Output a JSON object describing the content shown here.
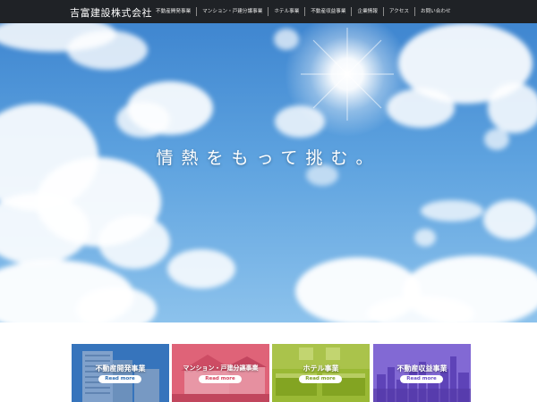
{
  "header": {
    "logo": "吉富建設株式会社",
    "nav": [
      "不動産開発事業",
      "マンション・戸建分譲事業",
      "ホテル事業",
      "不動産収益事業",
      "企業情報",
      "アクセス",
      "お問い合わせ"
    ]
  },
  "hero": {
    "tagline": "情熱をもって挑む。"
  },
  "cards": [
    {
      "title": "不動産開発事業",
      "button": "Read more",
      "color": "#2f6fb5"
    },
    {
      "title": "マンション・戸建分譲事業",
      "button": "Read more",
      "color": "#d6455f"
    },
    {
      "title": "ホテル事業",
      "button": "Read more",
      "color": "#8db02a"
    },
    {
      "title": "不動産収益事業",
      "button": "Read more",
      "color": "#6c4fc7"
    }
  ]
}
